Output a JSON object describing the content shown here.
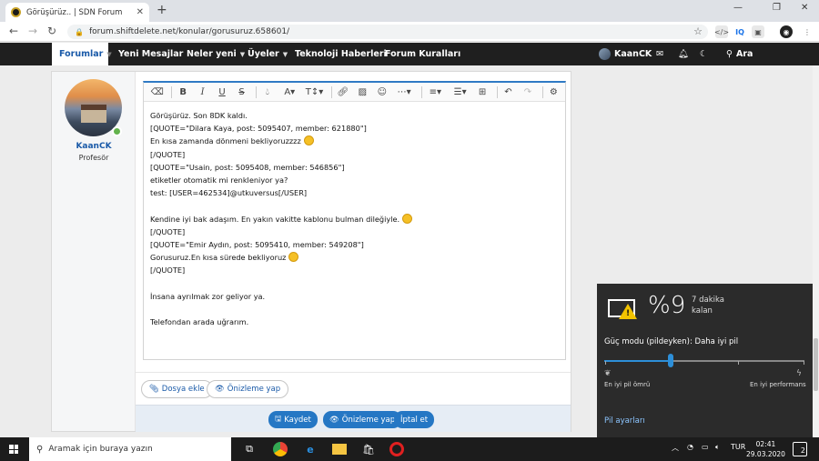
{
  "browser": {
    "tab_title": "Görüşürüz.. | SDN Forum",
    "tab_close": "✕",
    "new_tab": "+",
    "url": "forum.shiftdelete.net/konular/gorusuruz.658601/",
    "ext_iq": "IQ"
  },
  "sitenav": {
    "items": [
      "Forumlar",
      "Yeni Mesajlar",
      "Neler yeni",
      "Üyeler",
      "Teknoloji Haberleri",
      "Forum Kuralları"
    ],
    "user": "KaanCK",
    "search": "Ara"
  },
  "user": {
    "name": "KaanCK",
    "role": "Profesör"
  },
  "editor": {
    "lines": [
      "Görüşürüz. Son 8DK kaldı.",
      "[QUOTE=\"Dilara Kaya, post: 5095407, member: 621880\"]",
      "En kısa zamanda dönmeni bekliyoruzzzz",
      "[/QUOTE]",
      "[QUOTE=\"Usain, post: 5095408, member: 546856\"]",
      "etiketler otomatik mi renkleniyor ya?",
      "test: [USER=462534]@utkuversus[/USER]",
      "",
      "Kendine iyi bak adaşım. En yakın vakitte kablonu bulman dileğiyle.",
      "[/QUOTE]",
      "[QUOTE=\"Emir Aydın, post: 5095410, member: 549208\"]",
      "Gorusuruz.En kısa sürede bekliyoruz",
      "[/QUOTE]",
      "",
      "İnsana ayrılmak zor geliyor ya.",
      "",
      "Telefondan arada uğrarım."
    ]
  },
  "actions": {
    "attach": "Dosya ekle",
    "preview": "Önizleme yap",
    "save": "Kaydet",
    "preview2": "Önizleme yap",
    "cancel": "İptal et"
  },
  "battery": {
    "percent": "%9",
    "remaining": "7 dakika kalan",
    "mode_label": "Güç modu (pildeyken): Daha iyi pil",
    "slider_level": 0.33,
    "left_label": "En iyi pil ömrü",
    "right_label": "En iyi performans",
    "settings_link": "Pil ayarları"
  },
  "taskbar": {
    "search_placeholder": "Aramak için buraya yazın",
    "lang": "TUR",
    "time": "02:41",
    "date": "29.03.2020",
    "notifications": "2"
  },
  "colors": {
    "accent": "#2577c4",
    "navbar": "#1f1f1f",
    "flyout": "#2b2b2b",
    "slider": "#2d8fd9"
  }
}
